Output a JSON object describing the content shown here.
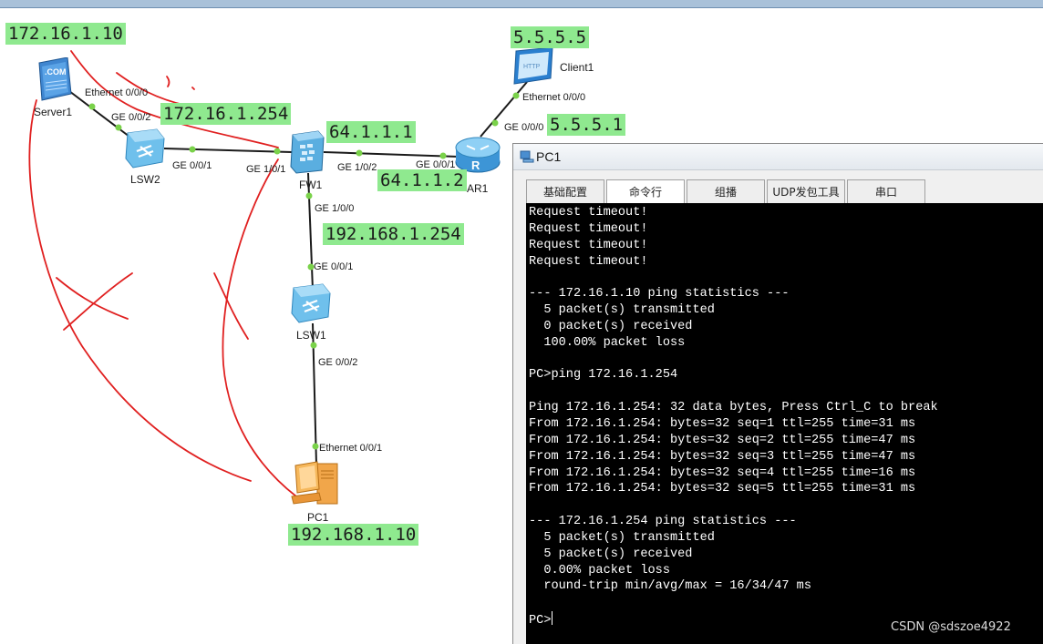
{
  "topology": {
    "ip_labels": {
      "server1_ip": "172.16.1.10",
      "lsw2_gw_ip": "172.16.1.254",
      "fw1_out_ip": "64.1.1.1",
      "ar1_ip": "64.1.1.2",
      "client1_ip": "5.5.5.5",
      "ar1_client_ip": "5.5.5.1",
      "fw1_in_ip": "192.168.1.254",
      "pc1_ip": "192.168.1.10"
    },
    "devices": {
      "server1": "Server1",
      "lsw2": "LSW2",
      "fw1": "FW1",
      "ar1": "AR1",
      "client1": "Client1",
      "lsw1": "LSW1",
      "pc1": "PC1"
    },
    "ports": {
      "server1_eth": "Ethernet 0/0/0",
      "lsw2_ge002": "GE 0/0/2",
      "lsw2_ge001": "GE 0/0/1",
      "fw1_ge101": "GE 1/0/1",
      "fw1_ge102": "GE 1/0/2",
      "ar1_ge001": "GE 0/0/1",
      "ar1_ge000": "GE 0/0/0",
      "client1_eth": "Ethernet 0/0/0",
      "fw1_ge100": "GE 1/0/0",
      "lsw1_ge001": "GE 0/0/1",
      "lsw1_ge002": "GE 0/0/2",
      "pc1_eth": "Ethernet 0/0/1"
    },
    "icon_texts": {
      "server_badge": ".COM",
      "client_badge": "HTTP",
      "router_letter": "R"
    }
  },
  "pc_window": {
    "title": "PC1",
    "tabs": [
      "基础配置",
      "命令行",
      "组播",
      "UDP发包工具",
      "串口"
    ],
    "active_tab": "命令行",
    "terminal_lines": [
      "Request timeout!",
      "Request timeout!",
      "Request timeout!",
      "Request timeout!",
      "",
      "--- 172.16.1.10 ping statistics ---",
      "  5 packet(s) transmitted",
      "  0 packet(s) received",
      "  100.00% packet loss",
      "",
      "PC>ping 172.16.1.254",
      "",
      "Ping 172.16.1.254: 32 data bytes, Press Ctrl_C to break",
      "From 172.16.1.254: bytes=32 seq=1 ttl=255 time=31 ms",
      "From 172.16.1.254: bytes=32 seq=2 ttl=255 time=47 ms",
      "From 172.16.1.254: bytes=32 seq=3 ttl=255 time=47 ms",
      "From 172.16.1.254: bytes=32 seq=4 ttl=255 time=16 ms",
      "From 172.16.1.254: bytes=32 seq=5 ttl=255 time=31 ms",
      "",
      "--- 172.16.1.254 ping statistics ---",
      "  5 packet(s) transmitted",
      "  5 packet(s) received",
      "  0.00% packet loss",
      "  round-trip min/avg/max = 16/34/47 ms",
      "",
      "PC>"
    ]
  },
  "watermark": "CSDN @sdszoe4922",
  "colors": {
    "ip_label_bg": "#8fe98f",
    "link_line": "#1a1a1a",
    "port_dot": "#7ad24a",
    "annotation_red": "#e02020",
    "terminal_bg": "#000000",
    "terminal_fg": "#ffffff"
  }
}
